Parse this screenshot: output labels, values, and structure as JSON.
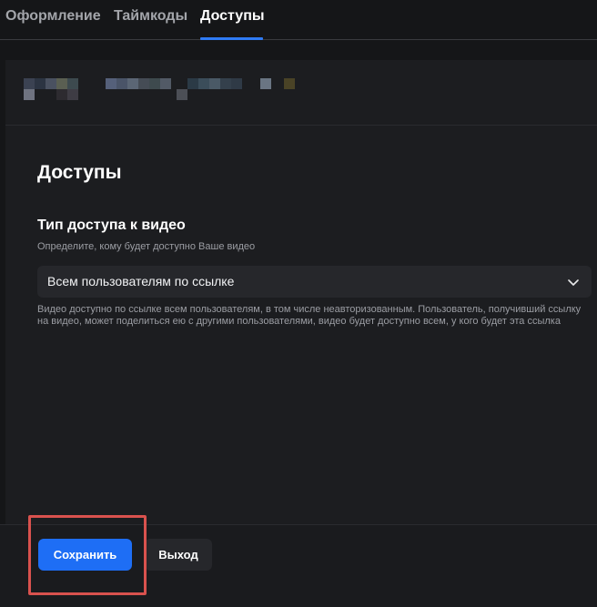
{
  "tabs": [
    {
      "label": "Оформление",
      "active": false
    },
    {
      "label": "Таймкоды",
      "active": false
    },
    {
      "label": "Доступы",
      "active": true
    }
  ],
  "section": {
    "title": "Доступы"
  },
  "access_field": {
    "label": "Тип доступа к видео",
    "hint": "Определите, кому будет доступно Ваше видео",
    "selected_value": "Всем пользователям по ссылке",
    "description": "Видео доступно по ссылке всем пользователям, в том числе неавторизованным. Пользователь, получивший ссылку на видео, может поделиться ею с другими пользователями, видео будет доступно всем, у кого будет эта ссылка"
  },
  "footer": {
    "save_label": "Сохранить",
    "exit_label": "Выход"
  },
  "colors": {
    "accent": "#1e6ef5",
    "tab_underline": "#2f7bf5",
    "highlight_border": "#d9524e",
    "background": "#151618"
  },
  "icons": {
    "select_chevron": "chevron-down-icon"
  }
}
